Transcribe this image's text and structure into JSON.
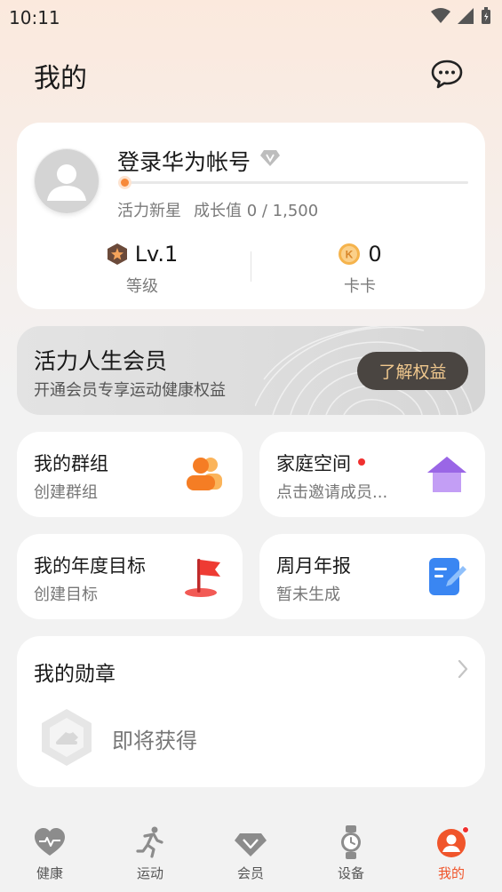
{
  "status_bar": {
    "time": "10:11"
  },
  "header": {
    "title": "我的",
    "message_icon": "chat-bubble-icon"
  },
  "profile": {
    "login_label": "登录华为帐号",
    "vip_icon": "diamond-icon",
    "growth_progress": 0,
    "level_name": "活力新星",
    "growth_text": "成长值 0 / 1,500",
    "level_value": "Lv.1",
    "level_label": "等级",
    "coins_value": "0",
    "coins_label": "卡卡"
  },
  "membership": {
    "title": "活力人生会员",
    "subtitle": "开通会员专享运动健康权益",
    "button": "了解权益",
    "button_bg": "#4a4541",
    "button_color": "#f0c88e"
  },
  "tiles": [
    {
      "title": "我的群组",
      "subtitle": "创建群组",
      "icon": "group-icon",
      "has_dot": false
    },
    {
      "title": "家庭空间",
      "subtitle": "点击邀请成员...",
      "icon": "home-icon",
      "has_dot": true
    },
    {
      "title": "我的年度目标",
      "subtitle": "创建目标",
      "icon": "flag-icon",
      "has_dot": false
    },
    {
      "title": "周月年报",
      "subtitle": "暂未生成",
      "icon": "report-icon",
      "has_dot": false
    }
  ],
  "badges": {
    "title": "我的勋章",
    "placeholder": "即将获得",
    "icon": "medal-icon"
  },
  "tabbar": {
    "items": [
      {
        "label": "健康",
        "icon": "heart-icon",
        "active": false
      },
      {
        "label": "运动",
        "icon": "running-icon",
        "active": false
      },
      {
        "label": "会员",
        "icon": "diamond-icon",
        "active": false
      },
      {
        "label": "设备",
        "icon": "watch-icon",
        "active": false
      },
      {
        "label": "我的",
        "icon": "person-icon",
        "active": true,
        "has_dot": true
      }
    ],
    "active_color": "#f0552b"
  }
}
